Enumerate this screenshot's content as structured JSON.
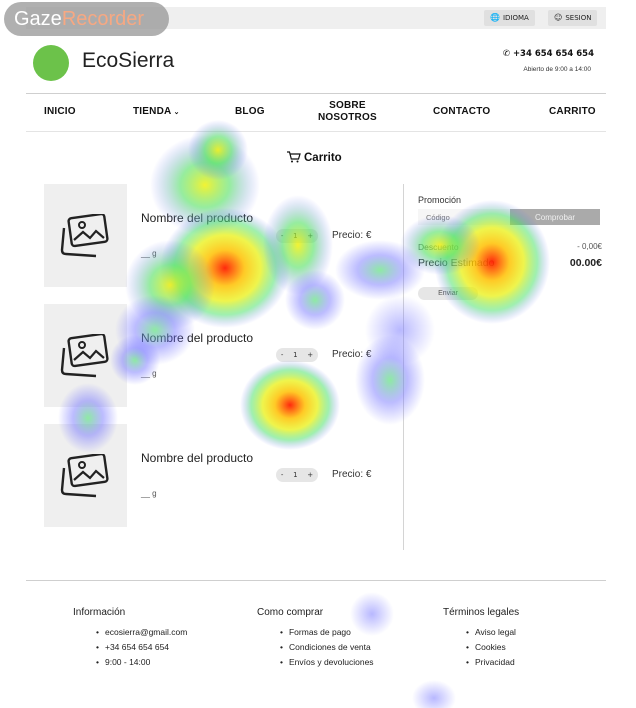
{
  "watermark": {
    "part1": "Gaze",
    "part2": "Recorder"
  },
  "topbar": {
    "language": "IDIOMA",
    "session": "SESION"
  },
  "header": {
    "brand": "EcoSierra",
    "phone": "+34 654 654 654",
    "hours": "Abierto de 9:00 a 14:00"
  },
  "nav": {
    "home": "INICIO",
    "store": "TIENDA",
    "blog": "BLOG",
    "about_1": "SOBRE",
    "about_2": "NOSOTROS",
    "contact": "CONTACTO",
    "cart": "CARRITO"
  },
  "cart": {
    "title": "Carrito",
    "products": [
      {
        "name": "Nombre del producto",
        "weight": "__ g",
        "qty": "1",
        "minus": "-",
        "plus": "+",
        "price": "Precio: €"
      },
      {
        "name": "Nombre del producto",
        "weight": "__ g",
        "qty": "1",
        "minus": "-",
        "plus": "+",
        "price": "Precio: €"
      },
      {
        "name": "Nombre del producto",
        "weight": "__ g",
        "qty": "1",
        "minus": "-",
        "plus": "+",
        "price": "Precio: €"
      }
    ]
  },
  "summary": {
    "promo_label": "Promoción",
    "promo_placeholder": "Código",
    "check_button": "Comprobar",
    "discount_label": "Descuento",
    "discount_value": "- 0,00€",
    "estimate_label": "Precio Estimado",
    "estimate_value": "00.00€",
    "send_button": "Enviar"
  },
  "footer": {
    "info": {
      "title": "Información",
      "items": [
        "ecosierra@gmail.com",
        "+34 654 654 654",
        "9:00 - 14:00"
      ]
    },
    "howto": {
      "title": "Como comprar",
      "items": [
        "Formas de pago",
        "Condiciones de venta",
        "Envíos y devoluciones"
      ]
    },
    "legal": {
      "title": "Términos legales",
      "items": [
        "Aviso legal",
        "Cookies",
        "Privacidad"
      ]
    }
  },
  "colors": {
    "brand_green": "#6cc24a",
    "heat_red": "#ff2a00",
    "heat_yellow": "#f5f500",
    "heat_blue": "#6a6aff"
  }
}
